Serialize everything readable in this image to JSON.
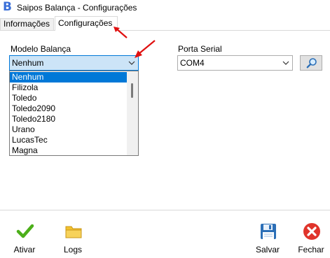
{
  "window": {
    "title": "Saipos Balança - Configurações",
    "app_icon_letter": "B"
  },
  "tabs": [
    {
      "label": "Informações",
      "active": false
    },
    {
      "label": "Configurações",
      "active": true
    }
  ],
  "form": {
    "scale_model": {
      "label": "Modelo Balança",
      "selected": "Nenhum",
      "options": [
        "Nenhum",
        "Filizola",
        "Toledo",
        "Toledo2090",
        "Toledo2180",
        "Urano",
        "LucasTec",
        "Magna"
      ],
      "dropdown_open": true
    },
    "serial_port": {
      "label": "Porta Serial",
      "selected": "COM4"
    }
  },
  "actions": {
    "activate_label": "Ativar",
    "logs_label": "Logs",
    "save_label": "Salvar",
    "close_label": "Fechar"
  },
  "colors": {
    "accent": "#0078d7",
    "annotation_arrow": "#e01010",
    "check_green": "#4caf1a",
    "close_red": "#e0342b",
    "folder_yellow": "#f2c12e",
    "save_blue": "#2c6fb7"
  },
  "icons": {
    "activate": "checkmark-icon",
    "logs": "folder-icon",
    "save": "floppy-disk-icon",
    "close": "close-x-icon",
    "search": "magnifier-icon"
  }
}
